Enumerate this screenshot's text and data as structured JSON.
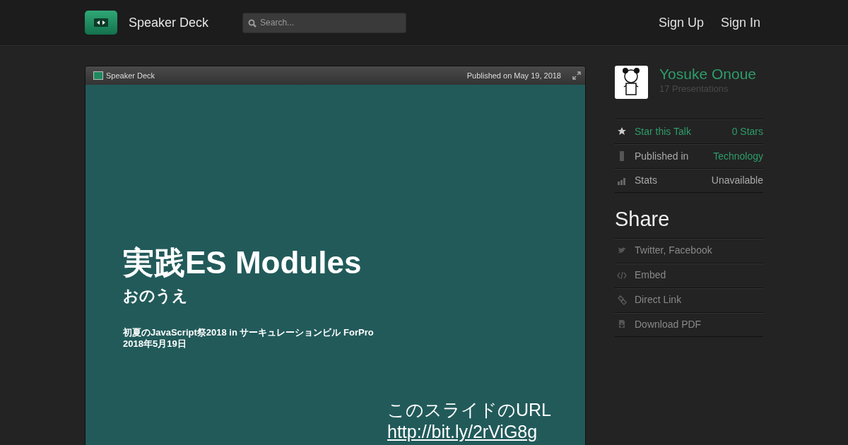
{
  "header": {
    "brand": "Speaker Deck",
    "search": {
      "placeholder": "Search..."
    },
    "nav": [
      "Sign Up",
      "Sign In"
    ]
  },
  "player": {
    "brand": "Speaker Deck",
    "published": "Published on May 19, 2018",
    "slide": {
      "title": "実践ES Modules",
      "author": "おのうえ",
      "event": "初夏のJavaScript祭2018 in サーキュレーションビル ForPro",
      "date": "2018年5月19日",
      "url_label": "このスライドのURL",
      "url": "http://bit.ly/2rViG8g"
    }
  },
  "sidebar": {
    "author": {
      "name": "Yosuke Onoue",
      "presentations": "17 Presentations"
    },
    "details": [
      {
        "kind": "star",
        "label": "Star this Talk",
        "label_link": true,
        "value": "0 Stars",
        "value_link": true
      },
      {
        "kind": "bookmark",
        "label": "Published in",
        "label_link": false,
        "value": "Technology",
        "value_link": true
      },
      {
        "kind": "stats",
        "label": "Stats",
        "label_link": false,
        "value": "Unavailable",
        "value_link": false
      }
    ],
    "share_title": "Share",
    "share": [
      {
        "kind": "bird",
        "label": "Twitter, Facebook"
      },
      {
        "kind": "code",
        "label": "Embed"
      },
      {
        "kind": "link",
        "label": "Direct Link"
      },
      {
        "kind": "download",
        "label": "Download PDF"
      }
    ]
  }
}
